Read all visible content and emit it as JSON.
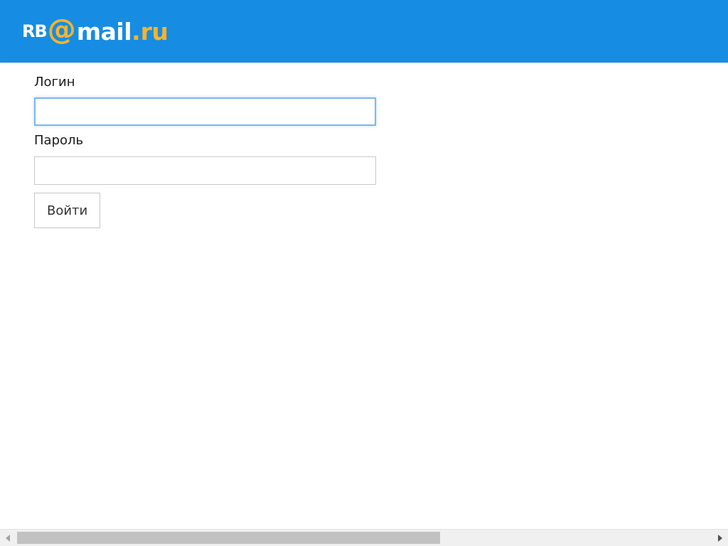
{
  "header": {
    "brand_color": "#168de2",
    "logo": {
      "prefix": "RB",
      "at": "@",
      "mail": "mail",
      "dot": ".",
      "ru": "ru",
      "accent_color": "#ffb229"
    }
  },
  "form": {
    "login_label": "Логин",
    "login_value": "",
    "password_label": "Пароль",
    "password_value": "",
    "submit_label": "Войти"
  },
  "scrollbar": {
    "orientation": "horizontal",
    "thumb_fraction": 0.61,
    "position": 0
  }
}
